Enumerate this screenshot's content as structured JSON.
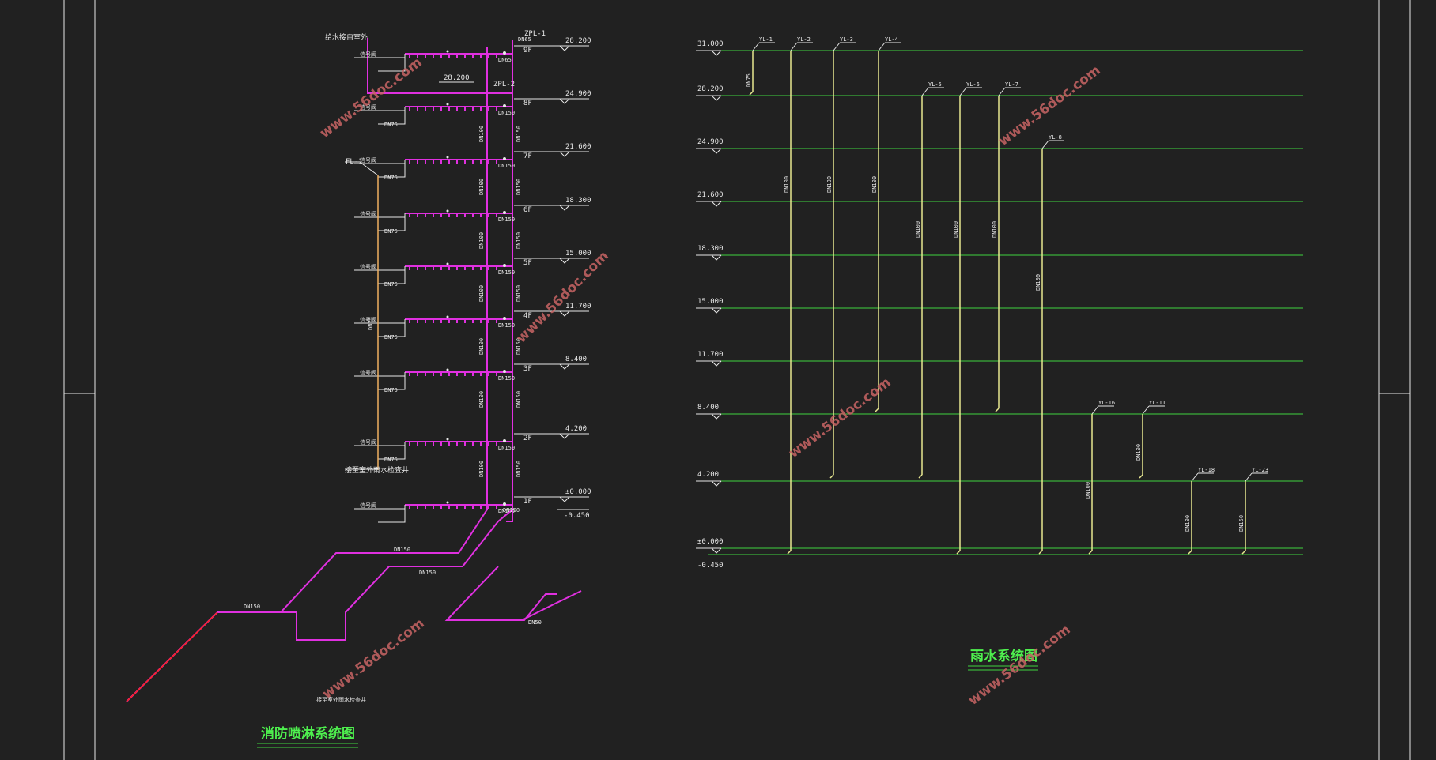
{
  "titles": {
    "sprinkler": "消防喷淋系统图",
    "rain": "雨水系统图"
  },
  "watermark": "www.56doc.com",
  "sprinkler": {
    "riser_labels": [
      "ZPL-1",
      "ZPL-2"
    ],
    "fl_label": "FL-1",
    "roof_level": "28.200",
    "floors": [
      {
        "floor": "9F",
        "level": "28.200"
      },
      {
        "floor": "8F",
        "level": "24.900"
      },
      {
        "floor": "7F",
        "level": "21.600"
      },
      {
        "floor": "6F",
        "level": "18.300"
      },
      {
        "floor": "5F",
        "level": "15.000"
      },
      {
        "floor": "4F",
        "level": "11.700"
      },
      {
        "floor": "3F",
        "level": "8.400"
      },
      {
        "floor": "2F",
        "level": "4.200"
      },
      {
        "floor": "1F",
        "level": "±0.000"
      }
    ],
    "basement_level": "-0.450",
    "pipe_labels": {
      "dn150": "DN150",
      "dn100": "DN100",
      "dn75": "DN75",
      "dn65": "DN65",
      "dn50": "DN50"
    }
  },
  "rain": {
    "levels": [
      "31.000",
      "28.200",
      "24.900",
      "21.600",
      "18.300",
      "15.000",
      "11.700",
      "8.400",
      "4.200",
      "±0.000"
    ],
    "basement_level": "-0.450",
    "pipes": [
      "YL-1",
      "YL-2",
      "YL-3",
      "YL-4",
      "YL-5",
      "YL-6",
      "YL-7",
      "YL-8",
      "YL-16",
      "YL-11",
      "YL-18",
      "YL-23"
    ],
    "pipe_sizes": {
      "dn75": "DN75",
      "dn100": "DN100",
      "dn150": "DN150"
    }
  }
}
